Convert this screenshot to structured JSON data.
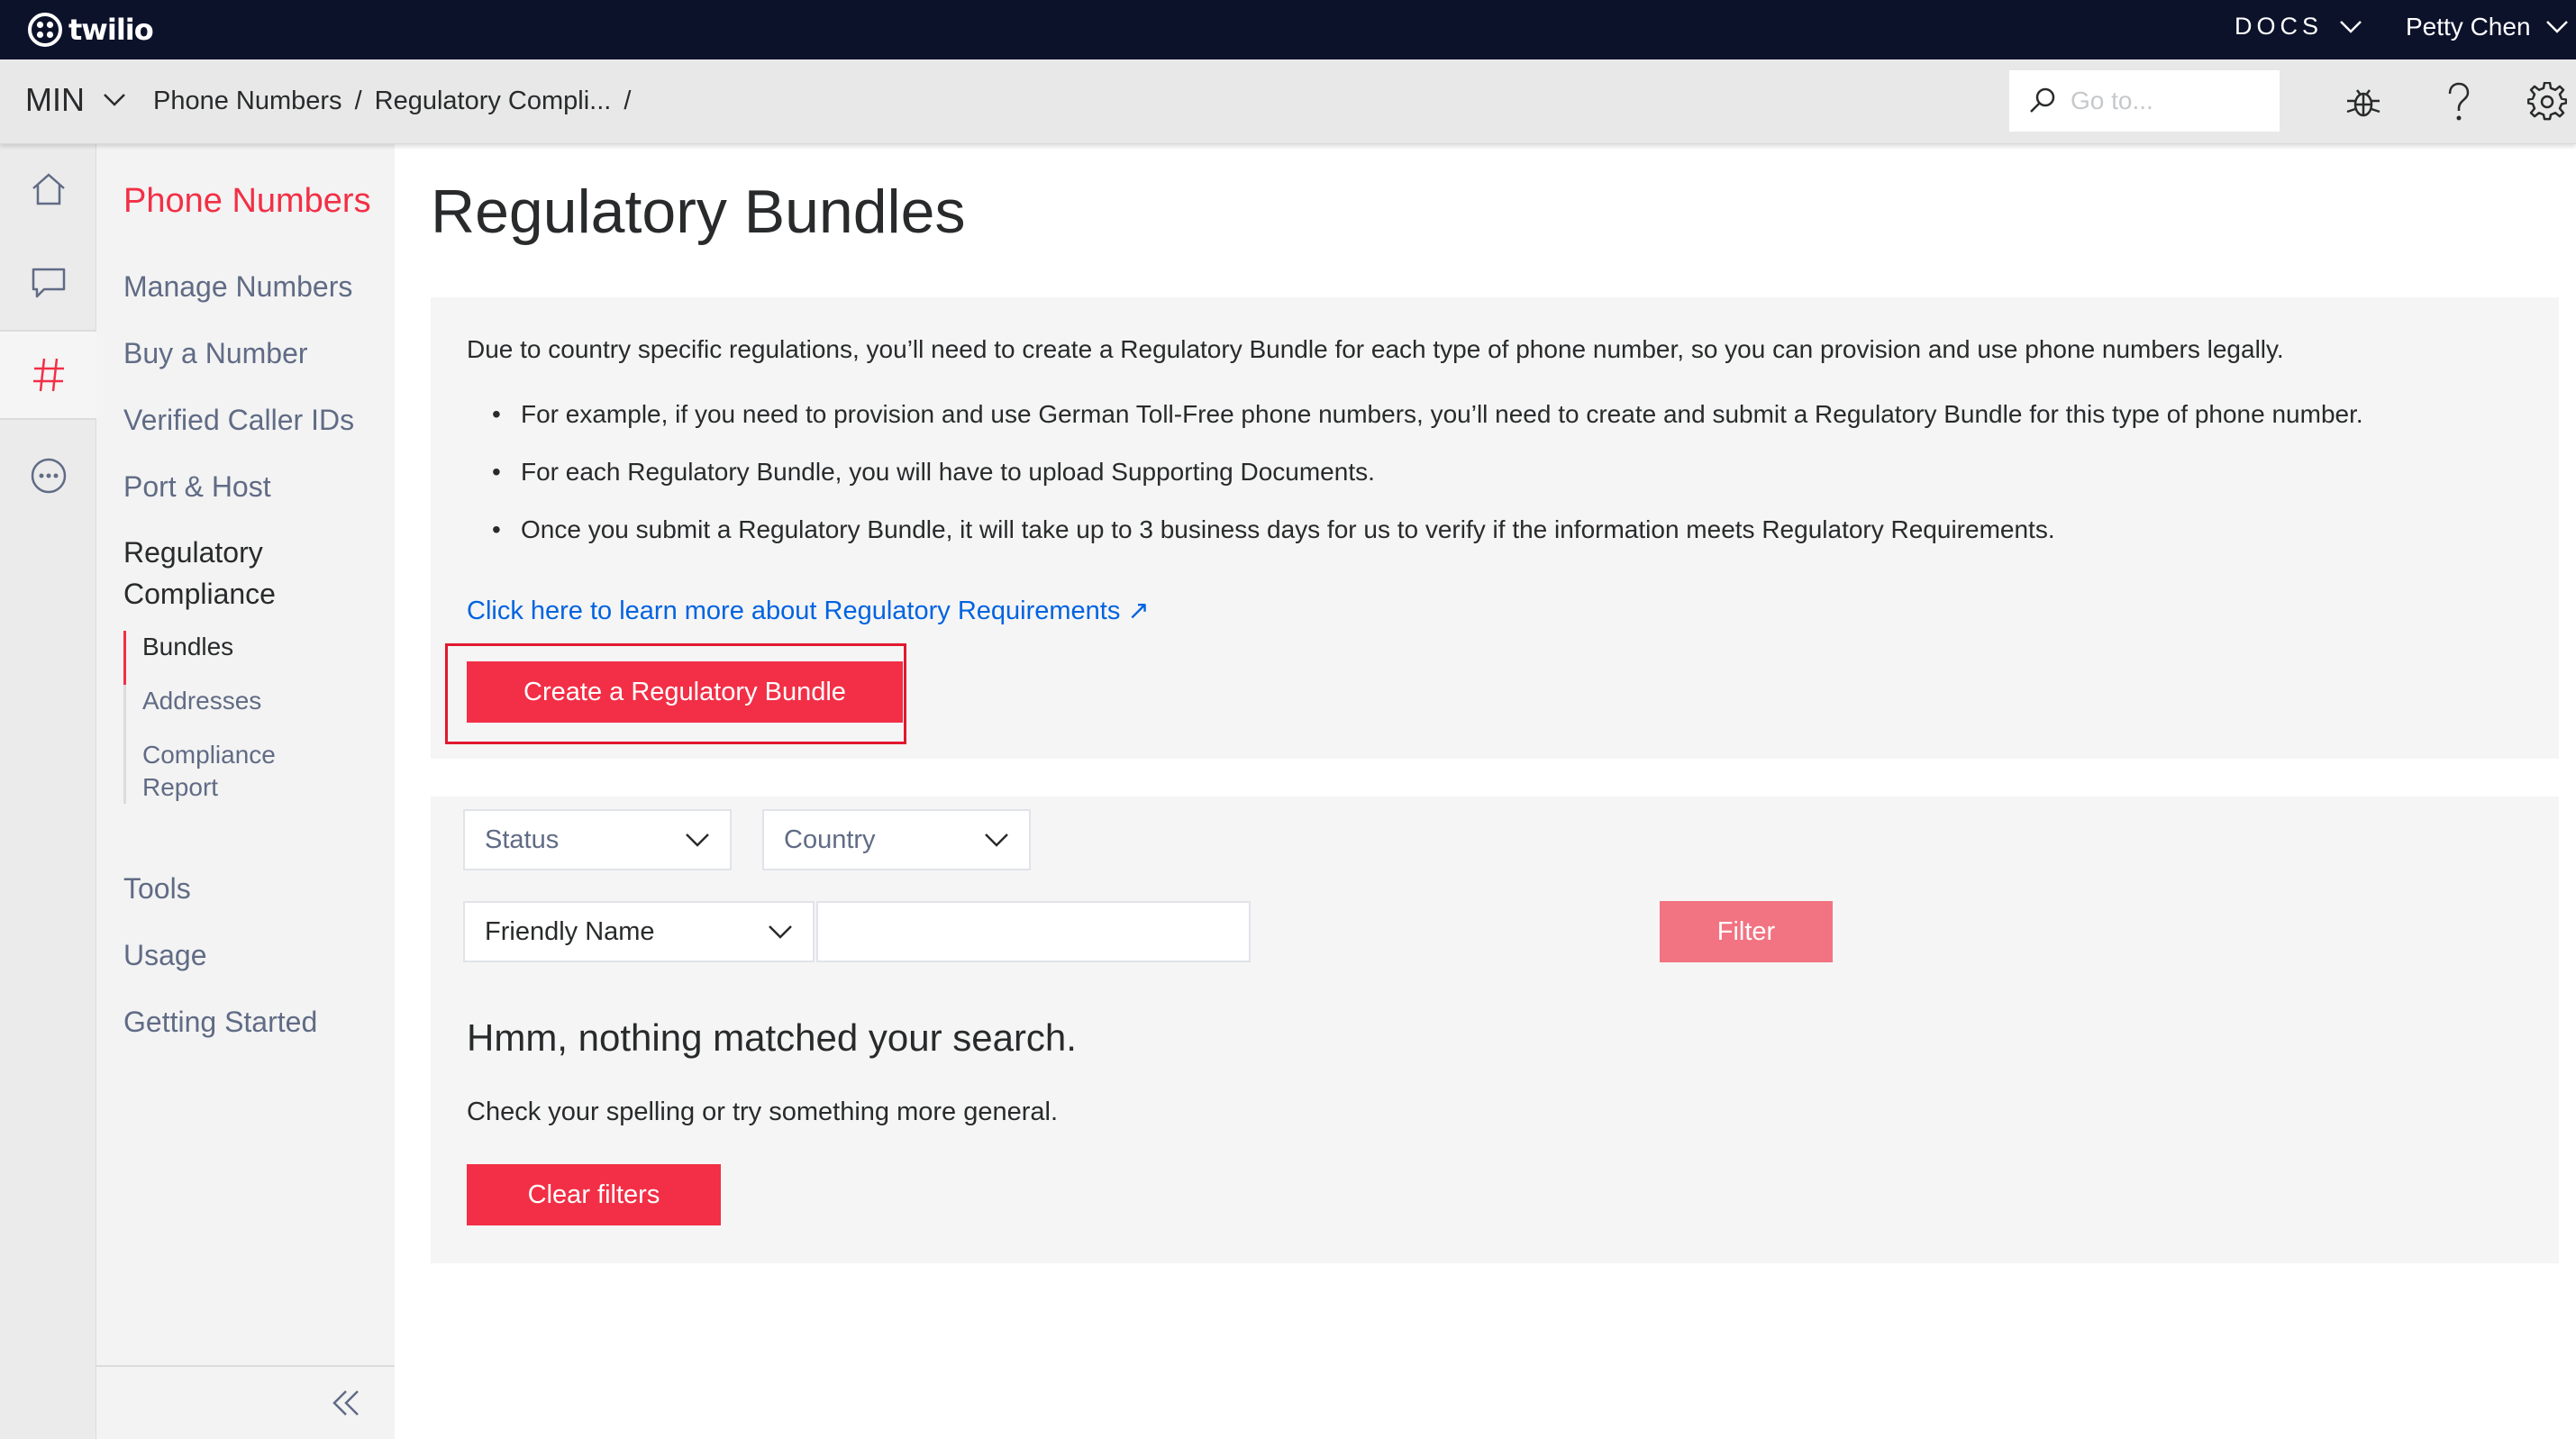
{
  "topbar": {
    "brand": "twilio",
    "docs_label": "DOCS",
    "user_name": "Petty Chen"
  },
  "subbar": {
    "account": "MIN",
    "breadcrumb": [
      "Phone Numbers",
      "/",
      "Regulatory Compli...",
      "/"
    ],
    "search_placeholder": "Go to..."
  },
  "icons": {
    "header": [
      "search-icon",
      "bug-icon",
      "help-icon",
      "gear-icon"
    ],
    "rail": [
      "home-icon",
      "chat-icon",
      "hash-icon",
      "more-icon"
    ]
  },
  "nav": {
    "title": "Phone Numbers",
    "items": [
      "Manage Numbers",
      "Buy a Number",
      "Verified Caller IDs",
      "Port & Host"
    ],
    "active_section": "Regulatory Compliance",
    "sub_items": [
      "Bundles",
      "Addresses",
      "Compliance Report"
    ],
    "bottom_items": [
      "Tools",
      "Usage",
      "Getting Started"
    ]
  },
  "main": {
    "title": "Regulatory Bundles",
    "intro": "Due to country specific regulations, you’ll need to create a Regulatory Bundle for each type of phone number, so you can provision and use phone numbers legally.",
    "bullets": [
      "For example, if you need to provision and use German Toll-Free phone numbers, you’ll need to create and submit a Regulatory Bundle for this type of phone number.",
      "For each Regulatory Bundle, you will have to upload Supporting Documents.",
      "Once you submit a Regulatory Bundle, it will take up to 3 business days for us to verify if the information meets Regulatory Requirements."
    ],
    "learn_link": "Click here to learn more about Regulatory Requirements ↗",
    "create_button": "Create a Regulatory Bundle"
  },
  "filters": {
    "status": "Status",
    "country": "Country",
    "field": "Friendly Name",
    "filter_value": "",
    "filter_button": "Filter",
    "empty_title": "Hmm, nothing matched your search.",
    "empty_sub": "Check your spelling or try something more general.",
    "clear_button": "Clear filters"
  },
  "colors": {
    "brand_red": "#f22f46",
    "topbar": "#0d122b",
    "link": "#0263e0",
    "highlight": "#e0192f"
  }
}
